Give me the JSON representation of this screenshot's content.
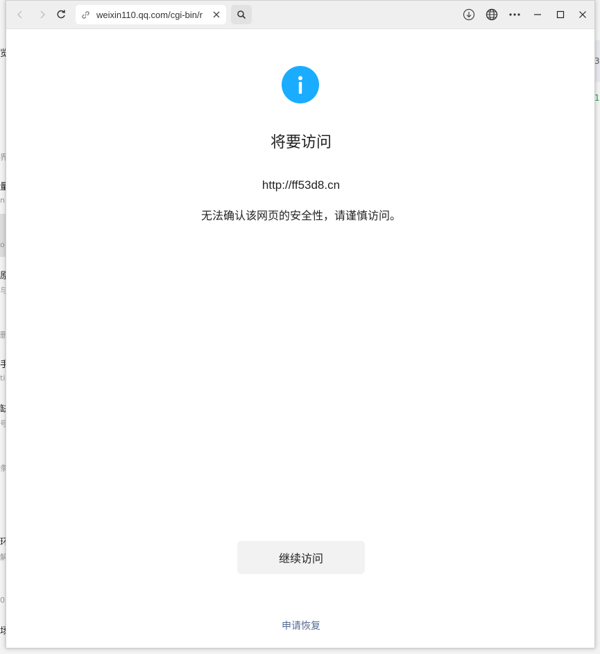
{
  "browser": {
    "url": "weixin110.qq.com/cgi-bin/r",
    "icons": [
      "back-icon",
      "forward-icon",
      "refresh-icon",
      "link-icon",
      "close-icon",
      "search-icon",
      "download-icon",
      "globe-icon",
      "more-icon",
      "minimize-icon",
      "maximize-icon",
      "window-close-icon"
    ]
  },
  "background_app": {
    "left_fragments": [
      "览",
      "界",
      "量",
      "n",
      "o",
      "原",
      "与",
      "删",
      "手",
      "ti",
      "缺",
      "号",
      "条",
      "环",
      "解",
      "0",
      "场"
    ],
    "right_fragments": [
      "3",
      "1"
    ]
  },
  "page": {
    "title": "将要访问",
    "url": "http://ff53d8.cn",
    "warning": "无法确认该网页的安全性，请谨慎访问。",
    "continue_label": "继续访问",
    "restore_label": "申请恢复"
  },
  "colors": {
    "info_blue": "#1aadff",
    "link_blue": "#576b95",
    "button_bg": "#f2f2f2"
  }
}
